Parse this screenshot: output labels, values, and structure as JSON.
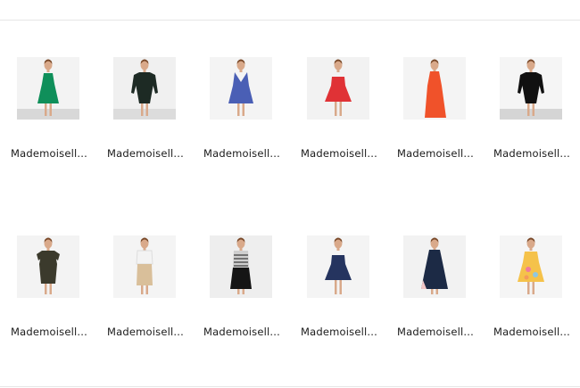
{
  "products": [
    {
      "name": "Mademoisell...",
      "dress_color": "#0f8f5a",
      "bg": "#f3f3f3",
      "floor": "#d8d8d8",
      "style": "sleeveless"
    },
    {
      "name": "Mademoisell...",
      "dress_color": "#1d2a24",
      "bg": "#f0f0f0",
      "floor": "#dcdcdc",
      "style": "sleeves"
    },
    {
      "name": "Mademoisell...",
      "dress_color": "#4a5fb5",
      "bg": "#f4f4f4",
      "floor": "#f4f4f4",
      "style": "vneck"
    },
    {
      "name": "Mademoisell...",
      "dress_color": "#e03236",
      "bg": "#f2f2f2",
      "floor": "#f2f2f2",
      "style": "strapless"
    },
    {
      "name": "Mademoisell...",
      "dress_color": "#f0522a",
      "bg": "#f4f4f4",
      "floor": "#f4f4f4",
      "style": "halter"
    },
    {
      "name": "Mademoisell...",
      "dress_color": "#111111",
      "bg": "#f5f5f5",
      "floor": "#d5d5d5",
      "style": "sleeves"
    },
    {
      "name": "Mademoisell...",
      "dress_color": "#3b3a2c",
      "bg": "#f3f3f3",
      "floor": "#f3f3f3",
      "style": "shortsleeve"
    },
    {
      "name": "Mademoisell...",
      "dress_color": "#d9bf9a",
      "bg": "#f4f4f4",
      "floor": "#f4f4f4",
      "style": "top-skirt"
    },
    {
      "name": "Mademoisell...",
      "dress_color": "#151515",
      "bg": "#eeeeee",
      "floor": "#eeeeee",
      "style": "stripe-top"
    },
    {
      "name": "Mademoisell...",
      "dress_color": "#25345f",
      "bg": "#f4f4f4",
      "floor": "#f4f4f4",
      "style": "strapless"
    },
    {
      "name": "Mademoisell...",
      "dress_color": "#1c2a45",
      "bg": "#f2f2f2",
      "floor": "#f2f2f2",
      "style": "slip"
    },
    {
      "name": "Mademoisell...",
      "dress_color": "#f5c24a",
      "bg": "#f5f5f5",
      "floor": "#f5f5f5",
      "style": "floral"
    }
  ]
}
